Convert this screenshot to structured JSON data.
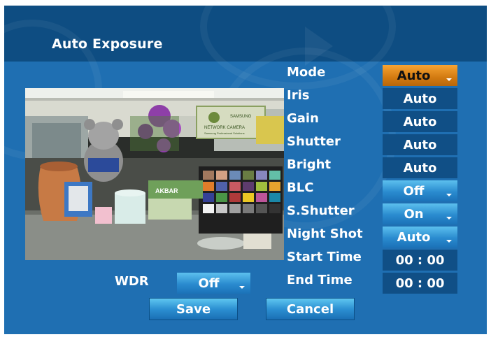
{
  "title": "Auto Exposure",
  "settings": [
    {
      "label": "Mode",
      "value": "Auto",
      "dropdown": true,
      "selected": true
    },
    {
      "label": "Iris",
      "value": "Auto",
      "dropdown": false
    },
    {
      "label": "Gain",
      "value": "Auto",
      "dropdown": false
    },
    {
      "label": "Shutter",
      "value": "Auto",
      "dropdown": false
    },
    {
      "label": "Bright",
      "value": "Auto",
      "dropdown": false
    },
    {
      "label": "BLC",
      "value": "Off",
      "dropdown": true
    },
    {
      "label": "S.Shutter",
      "value": "On",
      "dropdown": true
    },
    {
      "label": "Night Shot",
      "value": "Auto",
      "dropdown": true
    },
    {
      "label": "Start Time",
      "value": "00 : 00",
      "dropdown": false
    },
    {
      "label": "End Time",
      "value": "00 : 00",
      "dropdown": false
    }
  ],
  "wdr": {
    "label": "WDR",
    "value": "Off"
  },
  "buttons": {
    "save": "Save",
    "cancel": "Cancel"
  },
  "preview": {
    "sign_lines": [
      "SAMSUNG",
      "NETWORK CAMERA",
      "Samsung Professional Solutions"
    ],
    "box_label": "AKBAR"
  },
  "colors": {
    "panel": "#1f6fb2",
    "header": "#0e4d82",
    "value_box": "#104f86",
    "dropdown": "#2a8bcf",
    "selected": "#d27a10"
  }
}
